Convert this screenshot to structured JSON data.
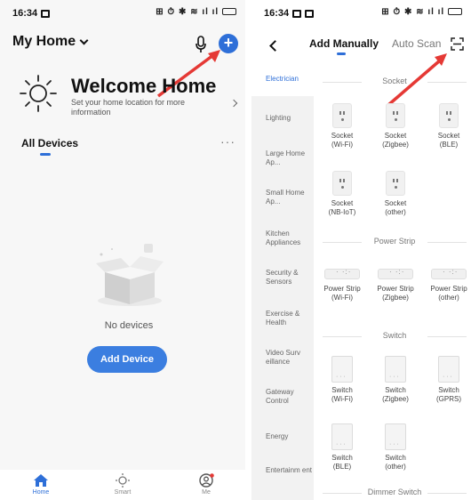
{
  "left_screen": {
    "status": {
      "time": "16:34",
      "icons": "⊞ ⏱ ✱ ≋ ıl ıl"
    },
    "home": {
      "title": "My Home"
    },
    "welcome": {
      "title": "Welcome Home",
      "subtitle": "Set your home location for more information"
    },
    "devices": {
      "header": "All Devices",
      "more": "···",
      "empty_text": "No devices",
      "add_button": "Add Device"
    },
    "bottom_nav": [
      {
        "label": "Home"
      },
      {
        "label": "Smart"
      },
      {
        "label": "Me"
      }
    ],
    "colors": {
      "accent": "#2e6fd8",
      "arrow": "#e53935"
    }
  },
  "right_screen": {
    "status": {
      "time": "16:34",
      "icons": "⊞ ⏱ ✱ ≋ ıl ıl"
    },
    "tabs": [
      {
        "label": "Add Manually"
      },
      {
        "label": "Auto Scan"
      }
    ],
    "categories": [
      {
        "label": "Electrician"
      },
      {
        "label": "Lighting"
      },
      {
        "label": "Large Home Ap..."
      },
      {
        "label": "Small Home Ap..."
      },
      {
        "label": "Kitchen Appliances"
      },
      {
        "label": "Security & Sensors"
      },
      {
        "label": "Exercise & Health"
      },
      {
        "label": "Video Surv eillance"
      },
      {
        "label": "Gateway Control"
      },
      {
        "label": "Energy"
      },
      {
        "label": "Entertainm ent"
      }
    ],
    "sections": {
      "socket": {
        "title": "Socket",
        "items": [
          {
            "line1": "Socket",
            "line2": "(Wi-Fi)"
          },
          {
            "line1": "Socket",
            "line2": "(Zigbee)"
          },
          {
            "line1": "Socket",
            "line2": "(BLE)"
          },
          {
            "line1": "Socket",
            "line2": "(NB-IoT)"
          },
          {
            "line1": "Socket",
            "line2": "(other)"
          }
        ]
      },
      "power_strip": {
        "title": "Power Strip",
        "items": [
          {
            "line1": "Power Strip",
            "line2": "(Wi-Fi)"
          },
          {
            "line1": "Power Strip",
            "line2": "(Zigbee)"
          },
          {
            "line1": "Power Strip",
            "line2": "(other)"
          }
        ]
      },
      "switch": {
        "title": "Switch",
        "items": [
          {
            "line1": "Switch",
            "line2": "(Wi-Fi)"
          },
          {
            "line1": "Switch",
            "line2": "(Zigbee)"
          },
          {
            "line1": "Switch",
            "line2": "(GPRS)"
          },
          {
            "line1": "Switch",
            "line2": "(BLE)"
          },
          {
            "line1": "Switch",
            "line2": "(other)"
          }
        ]
      },
      "dimmer": {
        "title": "Dimmer Switch"
      }
    }
  }
}
